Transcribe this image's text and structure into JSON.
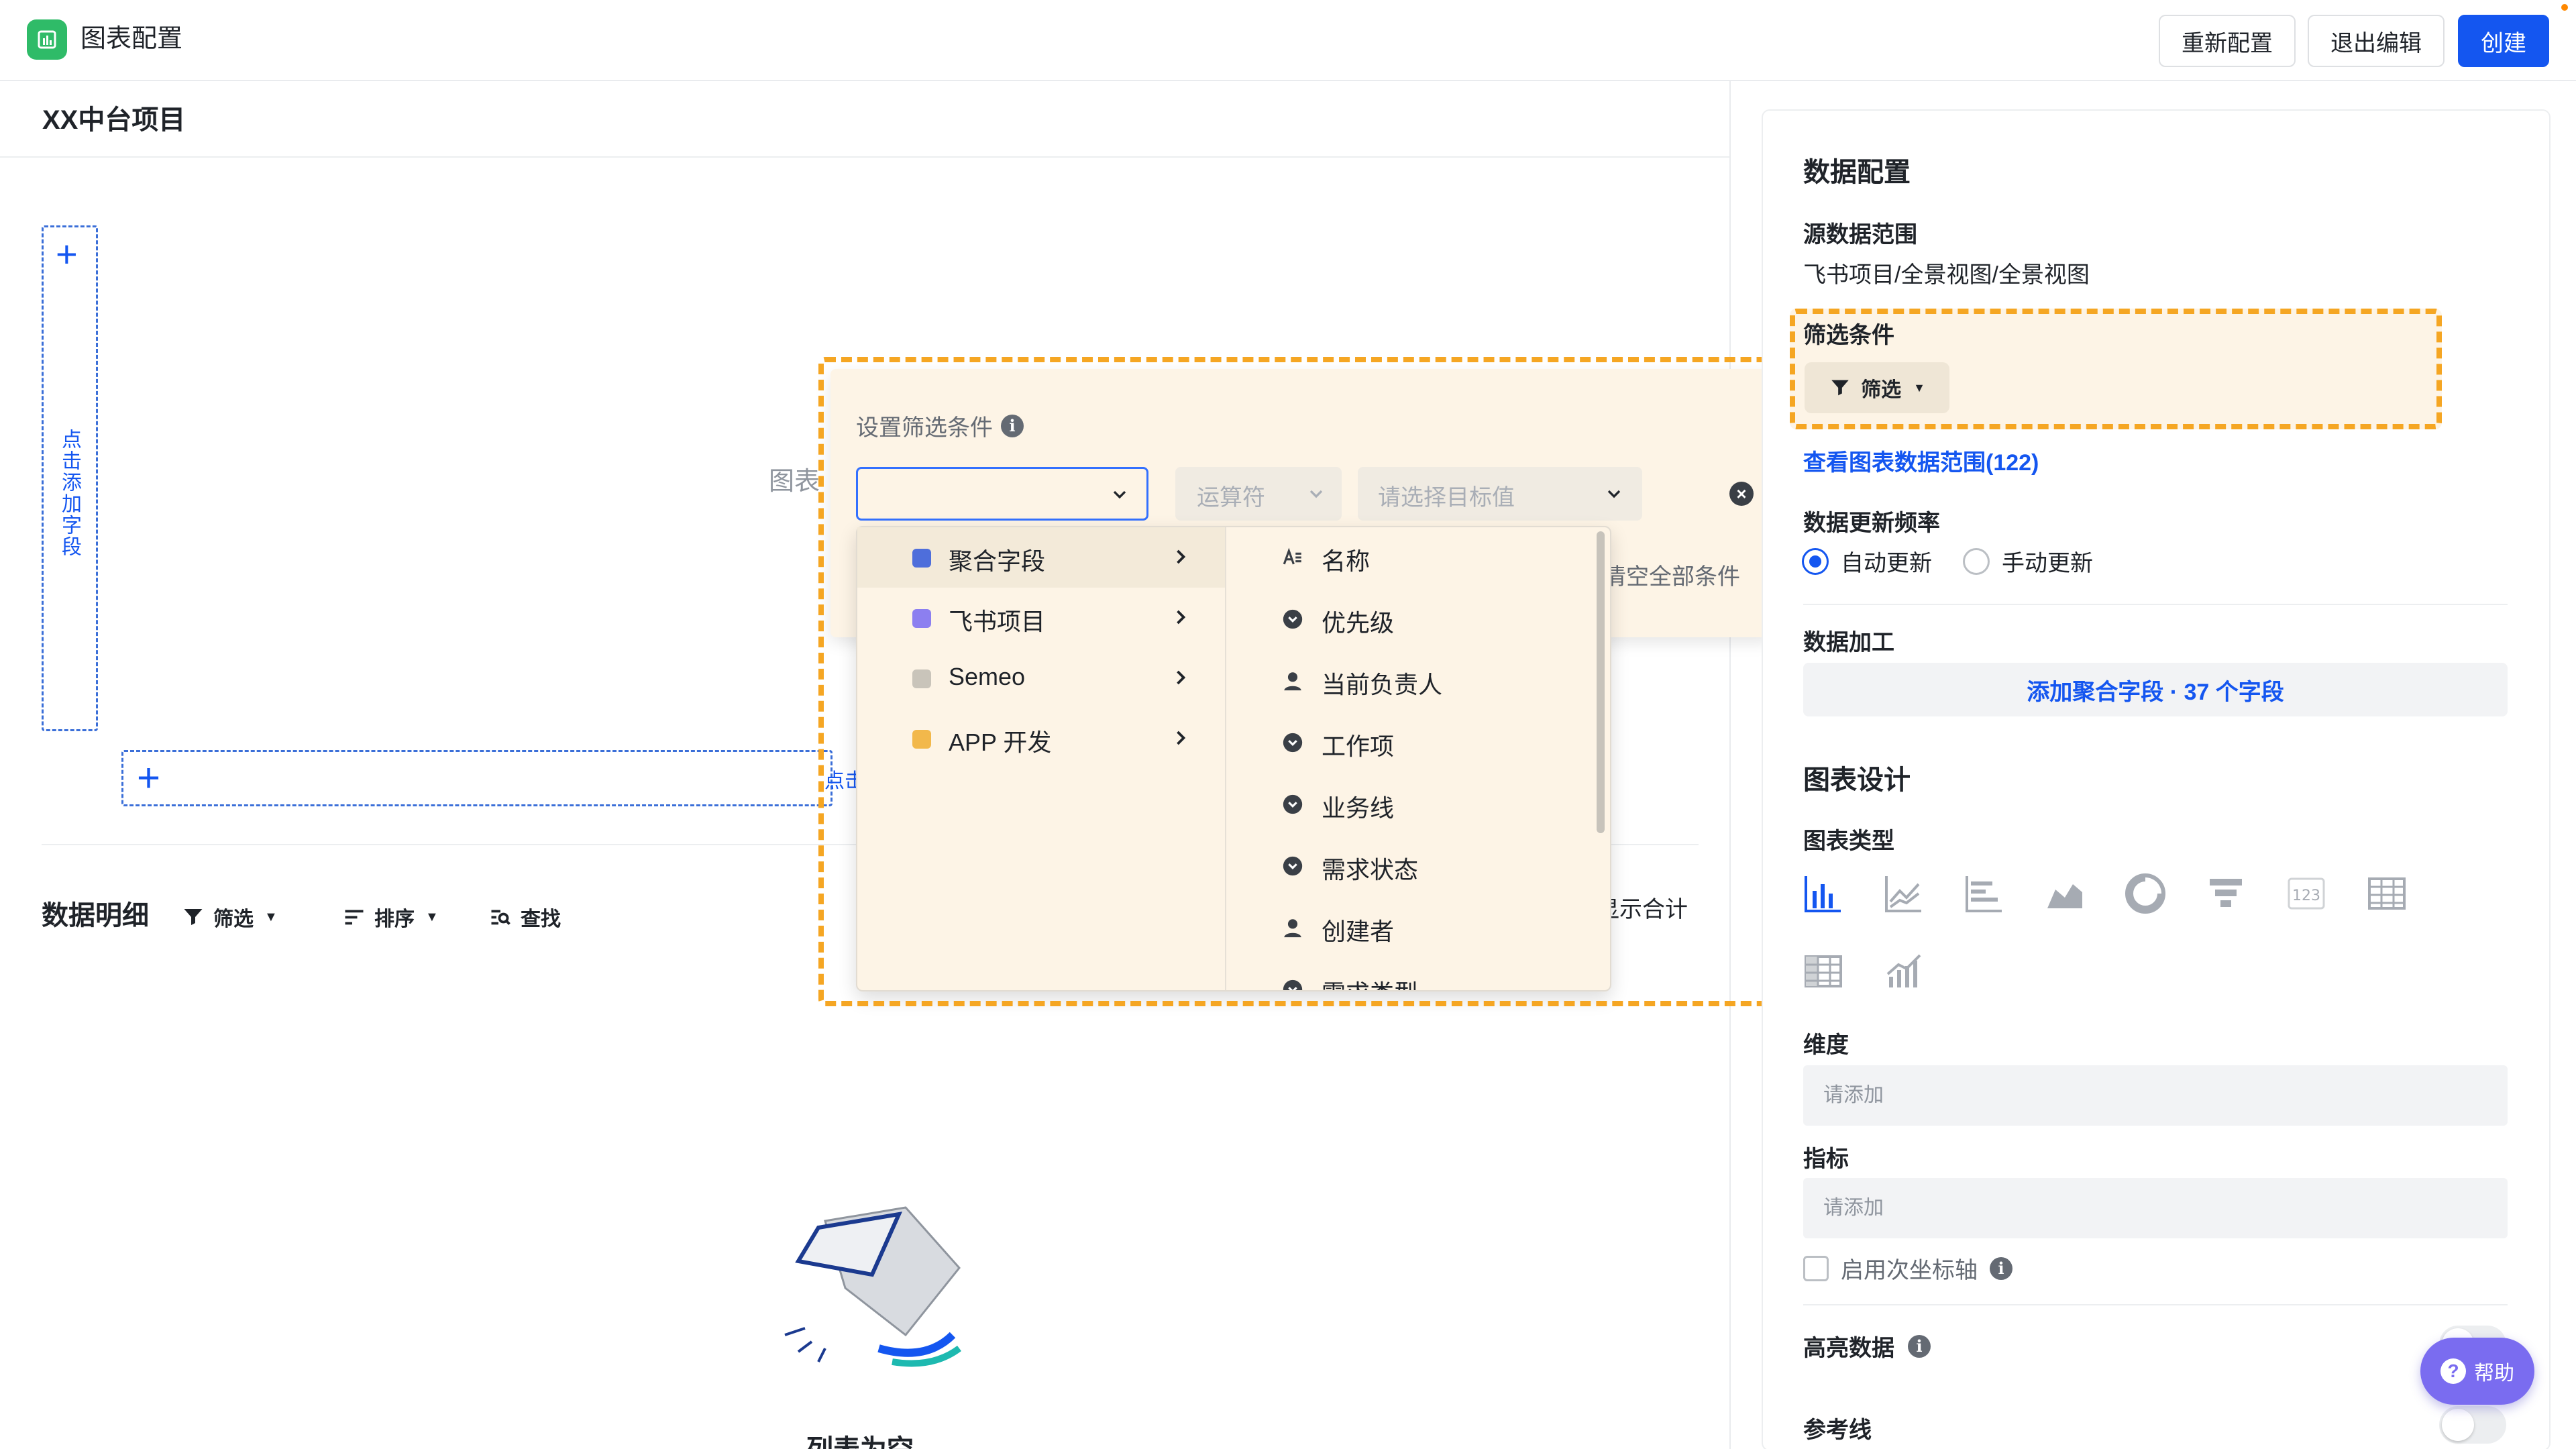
{
  "header": {
    "app_title": "图表配置",
    "buttons": {
      "reconfigure": "重新配置",
      "exit_edit": "退出编辑",
      "create": "创建"
    },
    "accent_color": "#1456f0"
  },
  "main": {
    "project_title": "XX中台项目",
    "add_field_vertical": "点击添加字段",
    "add_field_horizontal": "点击",
    "chart_placeholder": "图表",
    "detail": {
      "title": "数据明细",
      "tools": {
        "filter": "筛选",
        "sort": "排序",
        "find": "查找"
      },
      "show_total": "显示合计"
    },
    "empty_text": "列表为空"
  },
  "filter_popover": {
    "title": "设置筛选条件",
    "operator_placeholder": "运算符",
    "target_placeholder": "请选择目标值",
    "clear_all": "清空全部条件",
    "highlight_color": "#f5a623",
    "sources": [
      {
        "label": "聚合字段",
        "icon": "aggregate-field-icon",
        "active": true
      },
      {
        "label": "飞书项目",
        "icon": "feishu-project-icon",
        "active": false
      },
      {
        "label": "Semeo",
        "icon": "semeo-icon",
        "active": false
      },
      {
        "label": "APP 开发",
        "icon": "app-dev-icon",
        "active": false
      }
    ],
    "fields": [
      {
        "label": "名称",
        "icon": "text-field-icon"
      },
      {
        "label": "优先级",
        "icon": "select-field-icon"
      },
      {
        "label": "当前负责人",
        "icon": "person-field-icon"
      },
      {
        "label": "工作项",
        "icon": "select-field-icon"
      },
      {
        "label": "业务线",
        "icon": "select-field-icon"
      },
      {
        "label": "需求状态",
        "icon": "select-field-icon"
      },
      {
        "label": "创建者",
        "icon": "person-field-icon"
      },
      {
        "label": "需求类型",
        "icon": "select-field-icon"
      }
    ]
  },
  "right_panel": {
    "title": "数据配置",
    "source_label": "源数据范围",
    "source_value": "飞书项目/全景视图/全景视图",
    "filter_condition_label": "筛选条件",
    "filter_chip": "筛选",
    "view_range_link": "查看图表数据范围(122)",
    "update_freq_label": "数据更新频率",
    "update_options": {
      "auto": "自动更新",
      "manual": "手动更新",
      "selected": "auto"
    },
    "data_processing_label": "数据加工",
    "add_aggregate_button": "添加聚合字段 · 37 个字段",
    "chart_design_title": "图表设计",
    "chart_type_label": "图表类型",
    "chart_types": [
      "bar-chart-icon",
      "line-chart-icon",
      "horizontal-bar-icon",
      "area-chart-icon",
      "pie-chart-icon",
      "funnel-chart-icon",
      "number-card-icon",
      "table-icon",
      "pivot-table-icon",
      "combo-chart-icon"
    ],
    "selected_chart_type": "bar-chart-icon",
    "dimension_label": "维度",
    "dimension_placeholder": "请添加",
    "metric_label": "指标",
    "metric_placeholder": "请添加",
    "secondary_axis": "启用次坐标轴",
    "highlight_label": "高亮数据",
    "reference_line_label": "参考线",
    "help_button": "帮助"
  }
}
